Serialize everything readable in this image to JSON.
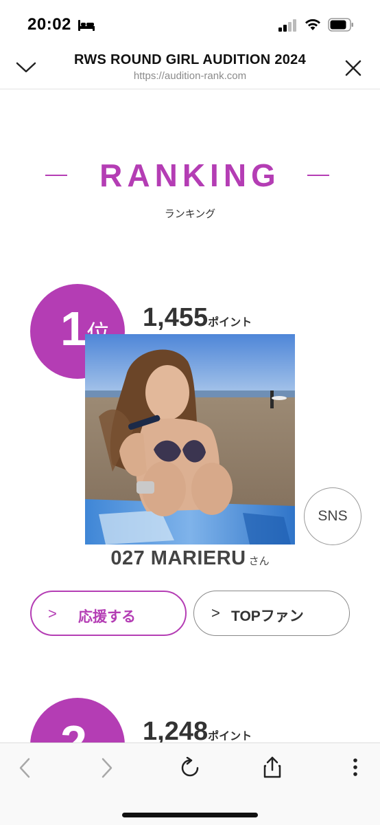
{
  "status_bar": {
    "time": "20:02",
    "icons": [
      "bed-icon",
      "signal-icon",
      "wifi-icon",
      "battery-icon"
    ]
  },
  "browser_header": {
    "title": "RWS ROUND GIRL AUDITION 2024",
    "url": "https://audition-rank.com",
    "icons": [
      "chevron-down-icon",
      "close-icon"
    ]
  },
  "section": {
    "heading": "RANKING",
    "subtitle": "ランキング"
  },
  "rankings": [
    {
      "rank": "1",
      "rank_suffix": "位",
      "points": "1,455",
      "points_unit": "ポイント",
      "entrant_name": "027 MARIERU",
      "entrant_suffix": "さん",
      "sns_label": "SNS",
      "support_label": "応援する",
      "top_fan_label": "TOPファン",
      "chevron": ">"
    },
    {
      "rank": "2",
      "points": "1,248",
      "points_unit": "ポイント"
    }
  ],
  "toolbar": {
    "icons": [
      "back-arrow-icon",
      "forward-arrow-icon",
      "reload-icon",
      "share-icon",
      "more-menu-icon"
    ]
  },
  "colors": {
    "accent": "#b43db4",
    "text": "#333333",
    "muted": "#8a8a8a"
  }
}
